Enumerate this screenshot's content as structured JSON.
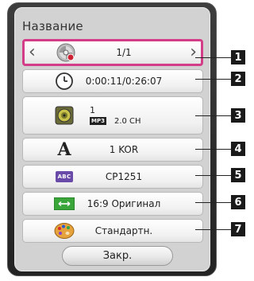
{
  "panel": {
    "title": "Название"
  },
  "rows": [
    {
      "value": "1/1",
      "icon": "disc-icon"
    },
    {
      "value": "0:00:11/0:26:07",
      "icon": "clock-icon"
    },
    {
      "audio_track": "1",
      "audio_format": "MP3",
      "audio_channels": "2.0 CH",
      "icon": "speaker-icon"
    },
    {
      "value": "1 KOR",
      "icon": "subtitle-letter-icon"
    },
    {
      "value": "CP1251",
      "icon": "codepage-abc-icon",
      "icon_text": "ABC"
    },
    {
      "value": "16:9 Оригинал",
      "icon": "aspect-ratio-icon"
    },
    {
      "value": "Стандартн.",
      "icon": "palette-icon"
    }
  ],
  "close_button": {
    "label": "Закр."
  },
  "callouts": [
    "1",
    "2",
    "3",
    "4",
    "5",
    "6",
    "7"
  ],
  "colors": {
    "selection_border": "#d33c86",
    "frame": "#2f2f2f",
    "panel": "#d2d2d2"
  }
}
